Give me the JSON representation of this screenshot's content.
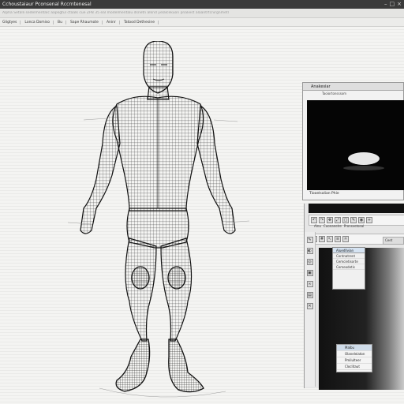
{
  "window": {
    "title": "Cchoustaiaur Pconsenal Rccrntenesal"
  },
  "path_bar": {
    "text": "Alpha Setalli sedelmentalc aapkgtul ctaalk cue ZPB 35 eal modelmentalu dsnetn alknd yelalcekuon pnaliest alaantrtcnirgnmetl"
  },
  "menu": {
    "items": [
      "Gligtyes",
      "Lonca Domiso",
      "Bu",
      "Sape Rhaumote",
      "Aninr",
      "Tatood Dethesine"
    ]
  },
  "float_panel": {
    "title": "Anakesiar",
    "subtitle": "Taoiortonsssom",
    "caption": "Tiooelsalian Phie"
  },
  "dock": {
    "tabs": [
      "Alnu",
      "Cuonanelre",
      "Pronsvetseal"
    ],
    "icons": [
      "undo-icon",
      "redo-icon",
      "move-icon",
      "scale-icon",
      "select-icon",
      "paint-icon",
      "camera-icon",
      "add-icon"
    ],
    "popup": {
      "header": "Aluedllvian",
      "rows": [
        "Contnatrent",
        "Cemcietisorte",
        "Cemeodetis"
      ]
    },
    "right_tab": "Ceet",
    "lower_list": [
      "Malbu",
      "Olaneleiaton",
      "Pmilulteer",
      "Cloclitaut"
    ]
  },
  "colors": {
    "titlebar": "#3a3a3a",
    "workspace": "#f4f4f2",
    "preview_bg": "#050505",
    "selection": "#cfdcea"
  }
}
